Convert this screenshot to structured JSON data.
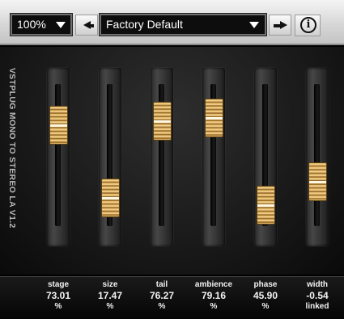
{
  "toolbar": {
    "zoom_value": "100%",
    "preset_value": "Factory Default",
    "info_glyph": "i"
  },
  "plugin": {
    "title": "VSTPLUG MONO TO STEREO LA V1.2"
  },
  "params": [
    {
      "name": "stage",
      "value": "73.01",
      "unit": "%",
      "level": 0.7301
    },
    {
      "name": "size",
      "value": "17.47",
      "unit": "%",
      "level": 0.1747
    },
    {
      "name": "tail",
      "value": "76.27",
      "unit": "%",
      "level": 0.7627
    },
    {
      "name": "ambience",
      "value": "79.16",
      "unit": "%",
      "level": 0.7916
    },
    {
      "name": "phase",
      "value": "45.90",
      "unit": "%",
      "level": 0.12
    },
    {
      "name": "width",
      "value": "-0.54",
      "unit": "linked",
      "level": 0.3
    }
  ],
  "colors": {
    "cap_gold": "#e0b15a",
    "panel_bg": "#1e1e1e",
    "toolbar_bg": "#d7d7d7"
  }
}
